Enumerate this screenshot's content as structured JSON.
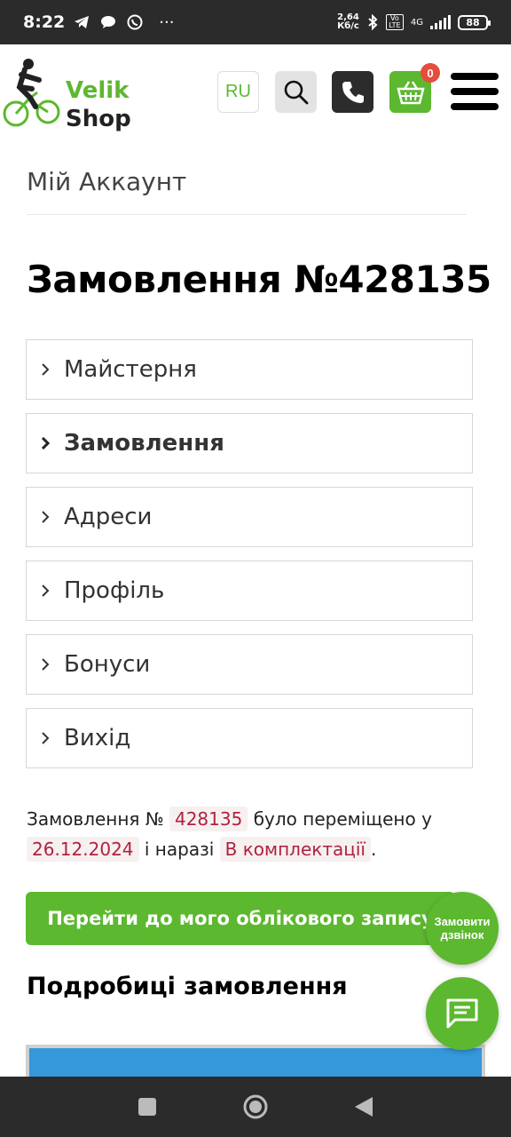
{
  "status_bar": {
    "time": "8:22",
    "icons": [
      "telegram-icon",
      "chat-bubble-icon",
      "viber-icon",
      "more-icon"
    ],
    "net_speed_value": "2,64",
    "net_speed_unit": "Кб/с",
    "volte": "Vo LTE",
    "network": "4G",
    "battery": "88"
  },
  "header": {
    "logo_line1": "Velik",
    "logo_line2": "Shop",
    "lang_button": "RU",
    "cart_count": "0",
    "brand_color": "#5cb82f"
  },
  "account": {
    "title": "Мій Аккаунт"
  },
  "page": {
    "title": "Замовлення №428135"
  },
  "nav": {
    "items": [
      {
        "label": "Майстерня",
        "active": false
      },
      {
        "label": "Замовлення",
        "active": true
      },
      {
        "label": "Адреси",
        "active": false
      },
      {
        "label": "Профіль",
        "active": false
      },
      {
        "label": "Бонуси",
        "active": false
      },
      {
        "label": "Вихід",
        "active": false
      }
    ]
  },
  "notice": {
    "prefix": "Замовлення №",
    "order_number": "428135",
    "moved_text": "було переміщено у",
    "date": "26.12.2024",
    "status_prefix": "і наразі",
    "status": "В комплектації",
    "suffix": "."
  },
  "buttons": {
    "account_link": "Перейти до мого облікового запису",
    "callback_line1": "Замовити",
    "callback_line2": "дзвінок"
  },
  "details": {
    "title": "Подробиці замовлення"
  }
}
